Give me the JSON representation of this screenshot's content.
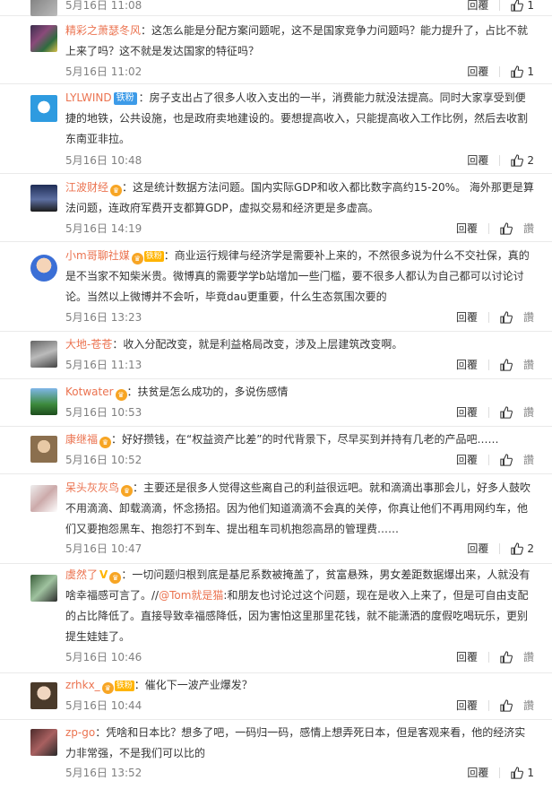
{
  "comments": [
    {
      "user": "",
      "content": "",
      "time": "5月16日 11:08",
      "reply": "回覆",
      "likes": "1"
    },
    {
      "user": "精彩之萧瑟冬风",
      "content": "：这怎么能是分配方案问题呢，这不是国家竞争力问题吗？能力提升了，占比不就上来了吗？这不就是发达国家的特征吗？",
      "time": "5月16日 11:02",
      "reply": "回覆",
      "likes": "1"
    },
    {
      "user": "LYLWIND",
      "badge": "铁粉",
      "content": "：房子支出占了很多人收入支出的一半，消费能力就没法提高。同时大家享受到便捷的地铁，公共设施，也是政府卖地建设的。要想提高收入，只能提高收入工作比例，然后去收割东南亚非拉。",
      "time": "5月16日 10:48",
      "reply": "回覆",
      "likes": "2"
    },
    {
      "user": "江波财经",
      "content": "：这是统计数据方法问题。国内实际GDP和收入都比数字高约15-20%。 海外那更是算法问题，连政府军费开支都算GDP，虚拟交易和经济更是多虚高。",
      "time": "5月16日 14:19",
      "reply": "回覆",
      "likes": ""
    },
    {
      "user": "小m哥聊社媒",
      "badge2": "铁粉",
      "content": "：商业运行规律与经济学是需要补上来的，不然很多说为什么不交社保，真的是不当家不知柴米贵。微博真的需要学学b站增加一些门槛，要不很多人都认为自己都可以讨论讨论。当然以上微博并不会听，毕竟dau更重要，什么生态氛围次要的",
      "time": "5月16日 13:23",
      "reply": "回覆",
      "likes": ""
    },
    {
      "user": "大地-苍苍",
      "content": "：收入分配改变，就是利益格局改变，涉及上层建筑改变啊。",
      "time": "5月16日 11:13",
      "reply": "回覆",
      "likes": ""
    },
    {
      "user": "Kotwater",
      "content": "：扶贫是怎么成功的，多说伤感情",
      "time": "5月16日 10:53",
      "reply": "回覆",
      "likes": ""
    },
    {
      "user": "康继福",
      "content": "：好好攒钱，在“权益资产比差”的时代背景下，尽早买到并持有几老的产品吧……",
      "time": "5月16日 10:52",
      "reply": "回覆",
      "likes": ""
    },
    {
      "user": "呆头灰灰鸟",
      "content": "：主要还是很多人觉得这些离自己的利益很远吧。就和滴滴出事那会儿，好多人鼓吹不用滴滴、卸载滴滴，怀念扬招。因为他们知道滴滴不会真的关停，你真让他们不再用网约车，他们又要抱怨黑车、抱怨打不到车、提出租车司机抱怨高昂的管理费……",
      "time": "5月16日 10:47",
      "reply": "回覆",
      "likes": "2"
    },
    {
      "user": "虞然了",
      "content": "：一切问题归根到底是基尼系数被掩盖了，贫富悬殊，男女差距数据爆出来，人就没有啥幸福感可言了。//",
      "mention": "@Tom就是猫",
      "content2": ":和朋友也讨论过这个问题，现在是收入上来了，但是可自由支配的占比降低了。直接导致幸福感降低，因为害怕这里那里花钱，就不能潇洒的度假吃喝玩乐，更别提生娃娃了。",
      "time": "5月16日 10:46",
      "reply": "回覆",
      "likes": ""
    },
    {
      "user": "zrhkx_",
      "badge2": "铁粉",
      "content": "：催化下一波产业爆发？",
      "time": "5月16日 10:44",
      "reply": "回覆",
      "likes": ""
    },
    {
      "user": "zp-go",
      "content": "：凭啥和日本比？想多了吧，一码归一码，感情上想弄死日本，但是客观来看，他的经济实力非常强，不是我们可以比的",
      "time": "5月16日 13:52",
      "reply": "回覆",
      "likes": "1"
    }
  ],
  "misc": {
    "tail_label": "讚"
  },
  "colors": {
    "link": "#eb7350",
    "meta": "#808080",
    "divider": "#eaeaea"
  }
}
